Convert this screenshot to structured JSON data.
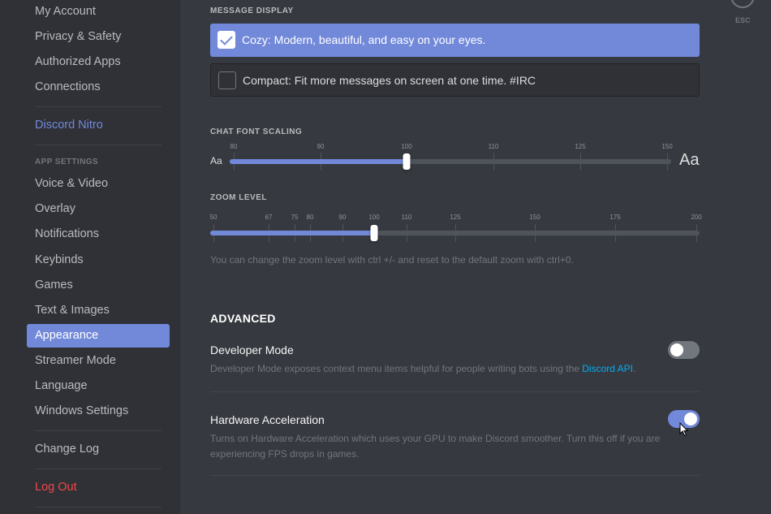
{
  "sidebar": {
    "user_items": [
      {
        "label": "My Account"
      },
      {
        "label": "Privacy & Safety"
      },
      {
        "label": "Authorized Apps"
      },
      {
        "label": "Connections"
      }
    ],
    "nitro_label": "Discord Nitro",
    "app_settings_header": "APP SETTINGS",
    "app_items": [
      {
        "label": "Voice & Video"
      },
      {
        "label": "Overlay"
      },
      {
        "label": "Notifications"
      },
      {
        "label": "Keybinds"
      },
      {
        "label": "Games"
      },
      {
        "label": "Text & Images"
      },
      {
        "label": "Appearance",
        "active": true
      },
      {
        "label": "Streamer Mode"
      },
      {
        "label": "Language"
      },
      {
        "label": "Windows Settings"
      }
    ],
    "change_log_label": "Change Log",
    "logout_label": "Log Out"
  },
  "close": {
    "label": "ESC",
    "icon": "close-icon"
  },
  "message_display": {
    "title": "MESSAGE DISPLAY",
    "options": [
      {
        "label": "Cozy: Modern, beautiful, and easy on your eyes.",
        "selected": true
      },
      {
        "label": "Compact: Fit more messages on screen at one time. #IRC",
        "selected": false
      }
    ]
  },
  "font_scaling": {
    "title": "CHAT FONT SCALING",
    "ticks": [
      "80",
      "90",
      "100",
      "110",
      "125",
      "150"
    ],
    "value": 100,
    "min_label": "Aa",
    "max_label": "Aa"
  },
  "zoom": {
    "title": "ZOOM LEVEL",
    "ticks": [
      "50",
      "67",
      "75",
      "80",
      "90",
      "100",
      "110",
      "125",
      "150",
      "175",
      "200"
    ],
    "value": 100,
    "hint": "You can change the zoom level with ctrl +/- and reset to the default zoom with ctrl+0."
  },
  "advanced": {
    "title": "ADVANCED",
    "developer_mode": {
      "title": "Developer Mode",
      "desc_prefix": "Developer Mode exposes context menu items helpful for people writing bots using the ",
      "link": "Discord API",
      "desc_suffix": ".",
      "enabled": false
    },
    "hardware_acceleration": {
      "title": "Hardware Acceleration",
      "desc": "Turns on Hardware Acceleration which uses your GPU to make Discord smoother. Turn this off if you are experiencing FPS drops in games.",
      "enabled": true
    }
  },
  "colors": {
    "accent": "#7289da",
    "background": "#36393f",
    "sidebar": "#2f3136",
    "danger": "#f04747",
    "link": "#00b0f4"
  }
}
